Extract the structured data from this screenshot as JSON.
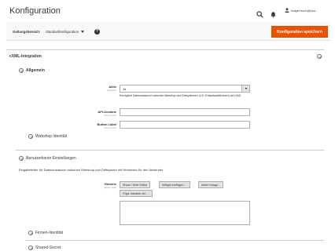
{
  "header": {
    "title": "Konfiguration",
    "user_name": "holger.esch@eco..."
  },
  "scope": {
    "label": "Geltungsbereich:",
    "value": "Standardkonfiguration",
    "help": "?",
    "save_label": "Konfiguration speichern"
  },
  "section": {
    "title": "cXML-Integration",
    "general": {
      "title": "Allgemein",
      "active": {
        "label": "Aktiv",
        "scope": "[website]",
        "value": "Ja",
        "note": "Ermöglicht Datenaustausch zwischen Webshop und Drittsystemen (z.B. Einkaufsplattformen) via cXML"
      },
      "api_domain": {
        "label": "API-Domäne",
        "scope": "[store view]",
        "value": ""
      },
      "button_label": {
        "label": "Button Label",
        "scope": "[store view]",
        "value": ""
      }
    },
    "webshop_identity": "Webshop Identität",
    "user_account": {
      "title": "Benutzerkonto Einstellungen",
      "description": "Eingabefelder für Datenaustausch zwischen Webshop und Drittsystem mit Hinweisen für den Anwender",
      "hint": {
        "label": "Hinweis",
        "scope": "[store view]",
        "buttons": [
          "Show / Hide Editor",
          "Widget einfügen ...",
          "Insert Image...",
          "Füge Variable ein ..."
        ],
        "value": ""
      }
    },
    "company_identity": "Firmen-Identität",
    "shared_secret": "Shared-Secret"
  }
}
